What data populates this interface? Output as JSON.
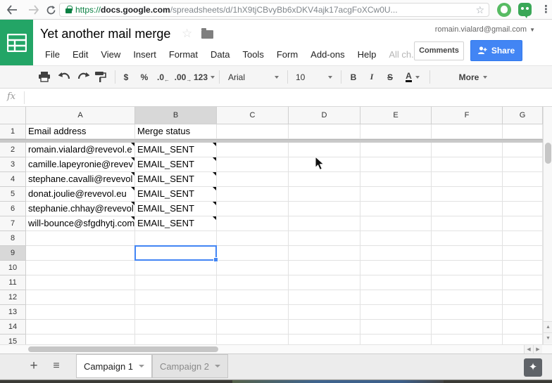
{
  "browser": {
    "url": {
      "protocol": "https://",
      "host": "docs.google.com",
      "path": "/spreadsheets/d/1hX9tjCBvyBb6xDKV4ajk17acgFoXCw0U..."
    },
    "menu_dots": "⋮",
    "bookmark_star": "☆"
  },
  "header": {
    "title": "Yet another mail merge",
    "star": "☆",
    "account_email": "romain.vialard@gmail.com",
    "menu": [
      "File",
      "Edit",
      "View",
      "Insert",
      "Format",
      "Data",
      "Tools",
      "Form",
      "Add-ons",
      "Help"
    ],
    "save_status": "All ch...",
    "comments_label": "Comments",
    "share_label": "Share"
  },
  "toolbar": {
    "currency": "$",
    "percent": "%",
    "decrease_decimal": ".0",
    "decrease_arrow": "←",
    "increase_decimal": ".00",
    "increase_arrow": "→",
    "number_format": "123",
    "font_family": "Arial",
    "font_size": "10",
    "bold": "B",
    "italic": "I",
    "strikethrough": "S",
    "text_color": "A",
    "more_label": "More"
  },
  "formula_bar": {
    "label": "fx"
  },
  "grid": {
    "column_headers": [
      "A",
      "B",
      "C",
      "D",
      "E",
      "F",
      "G"
    ],
    "selected_column": "B",
    "selected_row_number": 9,
    "row_count": 15,
    "frozen_rows": 1,
    "header_row": {
      "A": "Email address",
      "B": "Merge status"
    },
    "data_rows": [
      {
        "row": 2,
        "A": "romain.vialard@revevol.e",
        "B": "EMAIL_SENT",
        "note_a": true,
        "note_b": true
      },
      {
        "row": 3,
        "A": "camille.lapeyronie@revev",
        "B": "EMAIL_SENT",
        "note_a": true,
        "note_b": true
      },
      {
        "row": 4,
        "A": "stephane.cavalli@revevol",
        "B": "EMAIL_SENT",
        "note_a": true,
        "note_b": true
      },
      {
        "row": 5,
        "A": "donat.joulie@revevol.eu",
        "B": "EMAIL_SENT",
        "note_a": true,
        "note_b": true
      },
      {
        "row": 6,
        "A": "stephanie.chhay@revevol",
        "B": "EMAIL_SENT",
        "note_a": true,
        "note_b": true
      },
      {
        "row": 7,
        "A": "will-bounce@sfgdhytj.com",
        "B": "EMAIL_SENT",
        "note_a": true,
        "note_b": true
      }
    ],
    "selected_cell": "B9"
  },
  "scrollbars": {
    "left_arrow": "◀",
    "right_arrow": "▶",
    "up_arrow": "▲",
    "down_arrow": "▼"
  },
  "sheet_tabs": {
    "add_label": "+",
    "all_sheets_label": "≡",
    "explore_star": "✦",
    "tabs": [
      {
        "label": "Campaign 1",
        "active": true
      },
      {
        "label": "Campaign 2",
        "active": false
      }
    ]
  },
  "colors": {
    "sheets_green": "#23a566",
    "share_blue": "#4285f4",
    "selection_blue": "#4285f4",
    "secure_green": "#0b8043"
  }
}
